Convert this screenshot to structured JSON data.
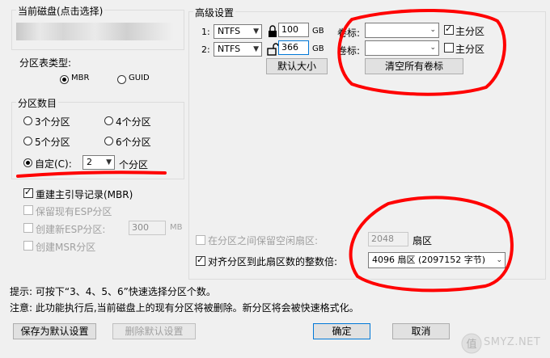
{
  "disk_group": {
    "title": "当前磁盘(点击选择)"
  },
  "partition_table": {
    "label": "分区表类型:",
    "options": [
      "MBR",
      "GUID"
    ],
    "selected": "MBR"
  },
  "partition_count": {
    "title": "分区数目",
    "options": [
      "3个分区",
      "4个分区",
      "5个分区",
      "6个分区"
    ],
    "custom_label": "自定(C):",
    "custom_value": "2",
    "custom_suffix": "个分区"
  },
  "checkboxes": {
    "rebuild_mbr": "重建主引导记录(MBR)",
    "keep_esp": "保留现有ESP分区",
    "create_esp": "创建新ESP分区:",
    "esp_size": "300",
    "esp_unit": "MB",
    "create_msr": "创建MSR分区"
  },
  "advanced": {
    "title": "高级设置",
    "rows": [
      {
        "index": "1:",
        "fs": "NTFS",
        "size": "100",
        "unit": "GB",
        "volume_label": "卷标:",
        "primary": "主分区",
        "primary_checked": true
      },
      {
        "index": "2:",
        "fs": "NTFS",
        "size": "366",
        "unit": "GB",
        "volume_label": "卷标:",
        "primary": "主分区",
        "primary_checked": false
      }
    ],
    "default_size_button": "默认大小",
    "clear_labels_button": "清空所有卷标",
    "free_sectors_label": "在分区之间保留空闲扇区:",
    "free_sectors_value": "2048",
    "free_sectors_unit": "扇区",
    "align_label": "对齐分区到此扇区数的整数倍:",
    "align_value": "4096 扇区 (2097152 字节)"
  },
  "notes": {
    "tip": "提示: 可按下“3、4、5、6”快速选择分区个数。",
    "warning": "注意: 此功能执行后,当前磁盘上的现有分区将被删除。新分区将会被快速格式化。"
  },
  "buttons": {
    "save_default": "保存为默认设置",
    "delete_default": "删除默认设置",
    "ok": "确定",
    "cancel": "取消"
  },
  "watermark": {
    "text": "SMYZ.NET"
  },
  "colors": {
    "annotation": "#ff0000",
    "primary_border": "#0078d7"
  }
}
